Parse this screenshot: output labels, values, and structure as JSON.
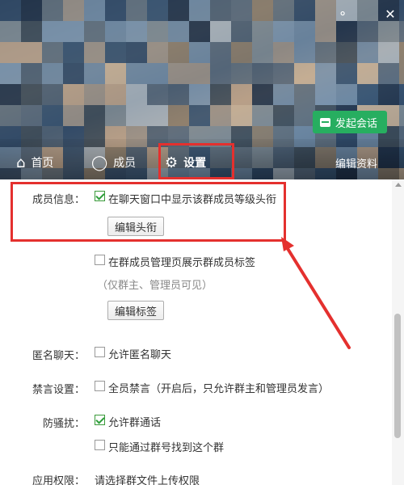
{
  "header": {
    "skin_icon": "skin-icon",
    "close_icon": "close-icon",
    "start_chat_label": "发起会话",
    "start_chat_icon": "chat-bubble-icon",
    "edit_profile_label": "编辑资料"
  },
  "tabs": [
    {
      "label": "首页",
      "icon": "home-icon"
    },
    {
      "label": "成员",
      "icon": "member-icon"
    },
    {
      "label": "设置",
      "icon": "gear-icon"
    }
  ],
  "settings": {
    "member_info_label": "成员信息：",
    "show_level_title": {
      "text": "在聊天窗口中显示该群成员等级头衔",
      "checked": true
    },
    "edit_title_button": "编辑头衔",
    "show_tags": {
      "text": "在群成员管理页展示群成员标签",
      "checked": false
    },
    "tags_note": "（仅群主、管理员可见）",
    "edit_tags_button": "编辑标签",
    "anon_label": "匿名聊天：",
    "allow_anon": {
      "text": "允许匿名聊天",
      "checked": false
    },
    "mute_label": "禁言设置：",
    "mute_all": {
      "text": "全员禁言（开启后，只允许群主和管理员发言）",
      "checked": false
    },
    "harass_label": "防骚扰：",
    "allow_group_call": {
      "text": "允许群通话",
      "checked": true
    },
    "find_by_number": {
      "text": "只能通过群号找到这个群",
      "checked": false
    },
    "perm_label": "应用权限：",
    "perm_value": "请选择群文件上传权限"
  },
  "colors": {
    "accent_green": "#27ae60",
    "annotation_red": "#e4302e"
  }
}
